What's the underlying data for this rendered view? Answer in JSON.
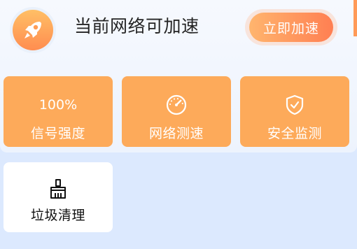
{
  "header": {
    "title": "当前网络可加速",
    "accelerate_button": "立即加速",
    "app_icon": "rocket-icon"
  },
  "tiles": [
    {
      "value": "100%",
      "label": "信号强度",
      "color": "#fdaa5a"
    },
    {
      "icon": "speedometer-icon",
      "label": "网络测速",
      "color": "#fdaa5a"
    },
    {
      "icon": "shield-check-icon",
      "label": "安全监测",
      "color": "#fdaa5a"
    },
    {
      "icon": "broom-icon",
      "label": "垃圾清理",
      "color": "#ffffff"
    }
  ],
  "colors": {
    "accent_orange": "#fdaa5a",
    "button_gradient_start": "#ffb56e",
    "button_gradient_end": "#ff7f52",
    "page_background": "#dce9fe"
  }
}
